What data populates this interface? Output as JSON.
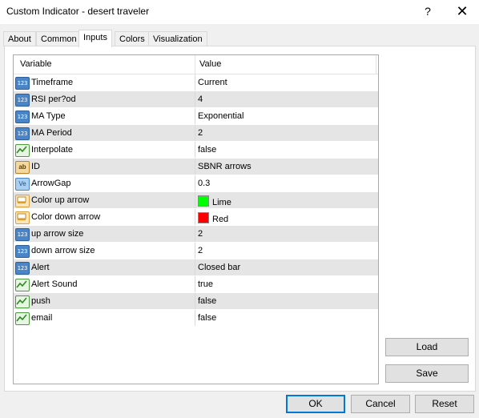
{
  "window": {
    "title": "Custom Indicator - desert traveler",
    "help_glyph": "?",
    "close_glyph": "✕"
  },
  "tabs": [
    "About",
    "Common",
    "Inputs",
    "Colors",
    "Visualization"
  ],
  "active_tab": "Inputs",
  "grid": {
    "headers": {
      "variable": "Variable",
      "value": "Value"
    },
    "rows": [
      {
        "icon": "number-icon",
        "variable": "Timeframe",
        "value": "Current"
      },
      {
        "icon": "number-icon",
        "variable": "RSI per?od",
        "value": "4"
      },
      {
        "icon": "number-icon",
        "variable": "MA Type",
        "value": "Exponential"
      },
      {
        "icon": "number-icon",
        "variable": "MA Period",
        "value": "2"
      },
      {
        "icon": "boolean-icon",
        "variable": "Interpolate",
        "value": "false"
      },
      {
        "icon": "string-icon",
        "variable": "ID",
        "value": "SBNR arrows"
      },
      {
        "icon": "double-icon",
        "variable": "ArrowGap",
        "value": "0.3"
      },
      {
        "icon": "color-icon",
        "variable": "Color up arrow",
        "value": "Lime",
        "swatch": "#00ff00"
      },
      {
        "icon": "color-icon",
        "variable": "Color down arrow",
        "value": "Red",
        "swatch": "#ff0000"
      },
      {
        "icon": "number-icon",
        "variable": "up arrow size",
        "value": "2"
      },
      {
        "icon": "number-icon",
        "variable": "down arrow size",
        "value": "2"
      },
      {
        "icon": "number-icon",
        "variable": "Alert",
        "value": "Closed bar"
      },
      {
        "icon": "boolean-icon",
        "variable": "Alert Sound",
        "value": "true"
      },
      {
        "icon": "boolean-icon",
        "variable": "push",
        "value": "false"
      },
      {
        "icon": "boolean-icon",
        "variable": "email",
        "value": "false"
      }
    ]
  },
  "buttons": {
    "load": "Load",
    "save": "Save",
    "ok": "OK",
    "cancel": "Cancel",
    "reset": "Reset"
  }
}
